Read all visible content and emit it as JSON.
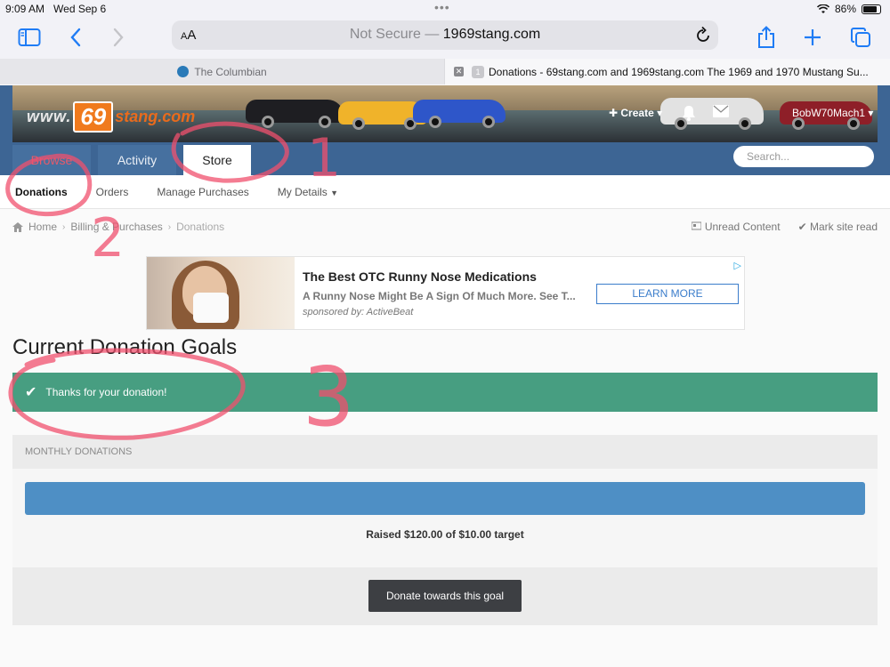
{
  "status_bar": {
    "time": "9:09 AM",
    "date": "Wed Sep 6",
    "battery": "86%",
    "battery_level": 0.86
  },
  "browser": {
    "aa_label": "AA",
    "not_secure": "Not Secure —",
    "domain": "1969stang.com",
    "tabs": [
      {
        "title": "The Columbian"
      },
      {
        "title": "Donations - 69stang.com and 1969stang.com The 1969 and 1970 Mustang Su...",
        "count": "1"
      }
    ]
  },
  "site": {
    "logo": {
      "www": "www.",
      "num": "69",
      "stang": "stang.com"
    },
    "create_label": "Create",
    "username": "BobW70Mach1",
    "nav": {
      "browse": "Browse",
      "activity": "Activity",
      "store": "Store"
    },
    "search_placeholder": "Search...",
    "subnav": {
      "donations": "Donations",
      "orders": "Orders",
      "manage": "Manage Purchases",
      "details": "My Details"
    },
    "breadcrumb": {
      "home": "Home",
      "billing": "Billing & Purchases",
      "current": "Donations"
    },
    "unread": "Unread Content",
    "mark_read": "Mark site read"
  },
  "ad": {
    "title": "The Best OTC Runny Nose Medications",
    "desc": "A Runny Nose Might Be A Sign Of Much More. See T...",
    "sponsor": "sponsored by: ActiveBeat",
    "cta": "LEARN MORE"
  },
  "main": {
    "title": "Current Donation Goals",
    "success": "Thanks for your donation!",
    "goal_heading": "MONTHLY DONATIONS",
    "raised": "Raised $120.00 of $10.00 target",
    "progress": 1.0,
    "donate_button": "Donate towards this goal"
  },
  "annotations": {
    "one": "1",
    "two": "2",
    "three": "3",
    "ink_color": "#f0506e"
  }
}
